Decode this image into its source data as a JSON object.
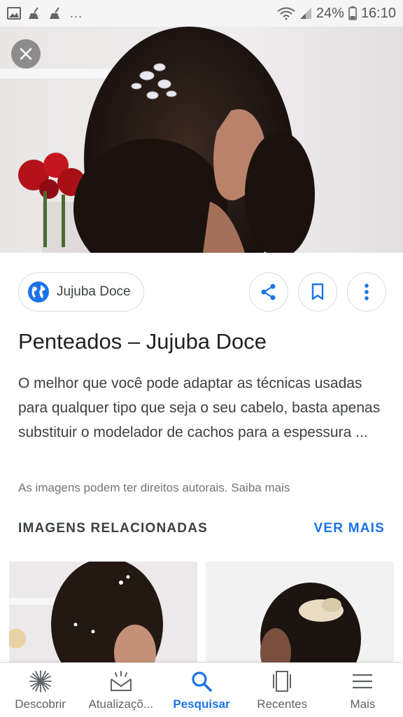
{
  "status_bar": {
    "notification_icons": [
      "gallery-icon",
      "broom-icon",
      "broom-icon"
    ],
    "overflow": "...",
    "battery": "24%",
    "time": "16:10"
  },
  "hero": {
    "close_icon": "close-icon"
  },
  "source": {
    "icon": "globe-icon",
    "name": "Jujuba Doce"
  },
  "actions": {
    "share_icon": "share-icon",
    "bookmark_icon": "bookmark-icon",
    "more_icon": "more-vert-icon"
  },
  "result": {
    "title": "Penteados – Jujuba Doce",
    "description": "O melhor que você pode adaptar as técnicas usadas para qualquer tipo que seja o seu cabelo, basta apenas substituir o modelador de cachos para a espessura ...",
    "copyright": "As imagens podem ter direitos autorais. Saiba mais"
  },
  "related": {
    "title": "IMAGENS RELACIONADAS",
    "see_more": "VER MAIS"
  },
  "bottom_nav": {
    "items": [
      {
        "label": "Descobrir",
        "icon": "asterisk-icon",
        "active": false
      },
      {
        "label": "Atualizaçõ...",
        "icon": "updates-icon",
        "active": false
      },
      {
        "label": "Pesquisar",
        "icon": "search-icon",
        "active": true
      },
      {
        "label": "Recentes",
        "icon": "recents-icon",
        "active": false
      },
      {
        "label": "Mais",
        "icon": "menu-icon",
        "active": false
      }
    ]
  },
  "colors": {
    "accent": "#1a73e8",
    "text": "#202124",
    "muted": "#70757a"
  }
}
